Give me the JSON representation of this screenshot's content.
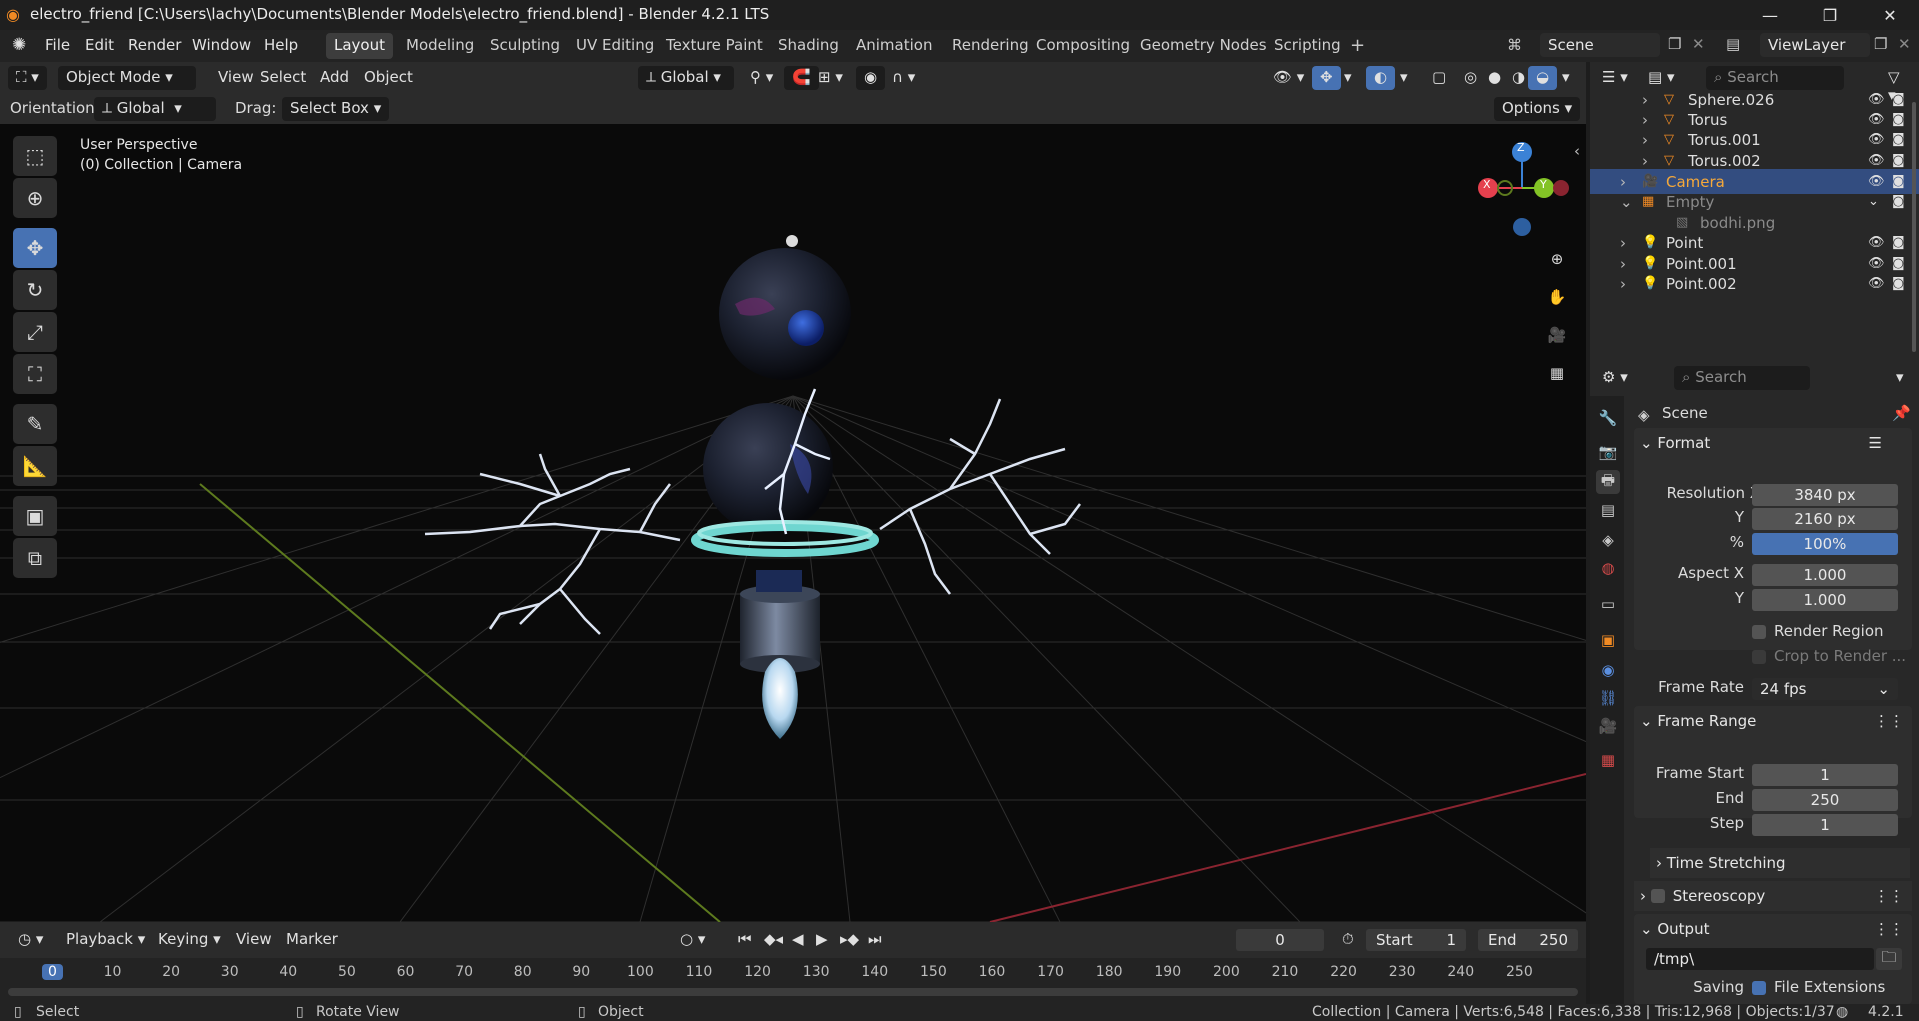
{
  "window": {
    "title": "electro_friend [C:\\Users\\lachy\\Documents\\Blender Models\\electro_friend.blend] - Blender 4.2.1 LTS",
    "minimize": "—",
    "maximize": "❐",
    "close": "✕"
  },
  "menu": {
    "file": "File",
    "edit": "Edit",
    "render": "Render",
    "window": "Window",
    "help": "Help"
  },
  "workspaces": [
    "Layout",
    "Modeling",
    "Sculpting",
    "UV Editing",
    "Texture Paint",
    "Shading",
    "Animation",
    "Rendering",
    "Compositing",
    "Geometry Nodes",
    "Scripting"
  ],
  "active_workspace": "Layout",
  "scene_name": "Scene",
  "view_layer": "ViewLayer",
  "viewport_header": {
    "mode": "Object Mode",
    "view": "View",
    "select": "Select",
    "add": "Add",
    "object": "Object",
    "transform": "Global"
  },
  "tool_settings": {
    "orientation_label": "Orientation:",
    "orientation_value": "Global",
    "drag_label": "Drag:",
    "drag_value": "Select Box",
    "options": "Options"
  },
  "viewport": {
    "perspective": "User Perspective",
    "collection": "(0) Collection | Camera",
    "gizmo_x": "X",
    "gizmo_y": "Y",
    "gizmo_z": "Z"
  },
  "outliner": {
    "search_placeholder": "Search",
    "items": [
      {
        "name": "Sphere.026",
        "selected": false
      },
      {
        "name": "Torus",
        "selected": false
      },
      {
        "name": "Torus.001",
        "selected": false
      },
      {
        "name": "Torus.002",
        "selected": false
      },
      {
        "name": "Camera",
        "selected": true
      },
      {
        "name": "Empty",
        "selected": false
      },
      {
        "name": "bodhi.png",
        "selected": false
      },
      {
        "name": "Point",
        "selected": false
      },
      {
        "name": "Point.001",
        "selected": false
      },
      {
        "name": "Point.002",
        "selected": false
      }
    ]
  },
  "properties": {
    "search_placeholder": "Search",
    "context": "Scene",
    "format": {
      "header": "Format",
      "res_x_label": "Resolution X",
      "res_x": "3840 px",
      "res_y_label": "Y",
      "res_y": "2160 px",
      "pct_label": "%",
      "pct": "100%",
      "aspect_x_label": "Aspect X",
      "aspect_x": "1.000",
      "aspect_y_label": "Y",
      "aspect_y": "1.000",
      "render_region": "Render Region",
      "crop": "Crop to Render ...",
      "frame_rate_label": "Frame Rate",
      "frame_rate": "24 fps"
    },
    "frame_range": {
      "header": "Frame Range",
      "start_label": "Frame Start",
      "start": "1",
      "end_label": "End",
      "end": "250",
      "step_label": "Step",
      "step": "1"
    },
    "time_stretching": "Time Stretching",
    "stereoscopy": "Stereoscopy",
    "output": {
      "header": "Output",
      "path": "/tmp\\",
      "saving_label": "Saving",
      "file_extensions": "File Extensions"
    }
  },
  "timeline": {
    "playback": "Playback",
    "keying": "Keying",
    "view": "View",
    "marker": "Marker",
    "current_frame": "0",
    "start_label": "Start",
    "start": "1",
    "end_label": "End",
    "end": "250",
    "ticks": [
      "0",
      "10",
      "20",
      "30",
      "40",
      "50",
      "60",
      "70",
      "80",
      "90",
      "100",
      "110",
      "120",
      "130",
      "140",
      "150",
      "160",
      "170",
      "180",
      "190",
      "200",
      "210",
      "220",
      "230",
      "240",
      "250"
    ]
  },
  "statusbar": {
    "select": "Select",
    "rotate": "Rotate View",
    "object": "Object",
    "stats": "Collection | Camera | Verts:6,548 | Faces:6,338 | Tris:12,968 | Objects:1/37",
    "version": "4.2.1"
  },
  "colors": {
    "accent": "#4772b3",
    "selected_object": "#f5a83a",
    "axis_x": "#e5404e",
    "axis_y": "#83c326",
    "axis_z": "#3b82d6"
  }
}
